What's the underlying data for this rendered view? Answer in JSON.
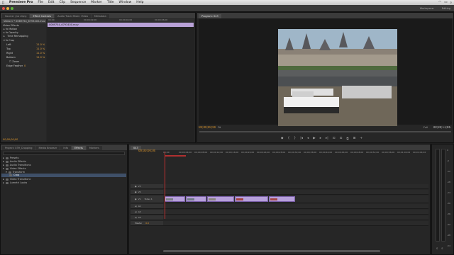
{
  "menubar": {
    "app_name": "Premiere Pro",
    "items": [
      "File",
      "Edit",
      "Clip",
      "Sequence",
      "Marker",
      "Title",
      "Window",
      "Help"
    ]
  },
  "titlebar": {
    "workspace_label": "Workspace:",
    "workspace_value": "Editing"
  },
  "effect_controls": {
    "tabs": [
      "Source: (no clips)",
      "Effect Controls",
      "Audio Track Mixer: Video",
      "Metadata"
    ],
    "clip_label": "Video 1 * 0069754_6793400.mov",
    "section": "Video Effects",
    "rows": [
      "Motion",
      "Opacity",
      "Time Remapping",
      "Crop",
      "Left",
      "Top",
      "Right",
      "Bottom",
      "Zoom",
      "Edge Feather"
    ],
    "values": {
      "left": "11.0 %",
      "top": "11.0 %",
      "right": "11.0 %",
      "bottom": "11.0 %",
      "edge": "0"
    },
    "timeline_clip": "0069754_6793400.mov",
    "ruler": [
      "00;00",
      "00;00;02;00",
      "00;00;04;00",
      "00;00;06;00"
    ],
    "timecode": "00;00;00;00"
  },
  "program": {
    "tab": "Program: 043",
    "timecode": "00;00;00;00",
    "fit": "Fit",
    "full": "Full",
    "duration": "00;00;11;06",
    "controls": [
      "◆",
      "{",
      "}",
      "|◂",
      "◂",
      "▶",
      "▸",
      "▸|",
      "⊡",
      "⊡",
      "⧉",
      "⊞",
      "+"
    ]
  },
  "project": {
    "tabs": [
      "Project: 039_Cropping",
      "Media Browser",
      "Info",
      "Effects",
      "Markers"
    ],
    "active_tab": "Effects",
    "items": [
      "Presets",
      "Audio Effects",
      "Audio Transitions",
      "Video Effects",
      "Transform",
      "Crop",
      "Video Transitions",
      "Lumetri Looks"
    ]
  },
  "timeline": {
    "tab": "043",
    "timecode": "00;00;00;00",
    "ruler": [
      "00;00",
      "00;00;04;00",
      "00;00;08;00",
      "00;00;12;00",
      "00;00;16;00",
      "00;00;20;00",
      "00;00;24;00",
      "00;00;28;00",
      "00;00;32;00",
      "00;00;36;00",
      "00;00;40;00",
      "00;00;44;00",
      "00;00;48;00",
      "00;00;52;00",
      "00;00;56;00",
      "00;01;00;02",
      "00;01;04;02"
    ],
    "tracks": [
      {
        "name": "V3"
      },
      {
        "name": "V2"
      },
      {
        "name": "V1",
        "label": "Video 1"
      },
      {
        "name": "A1"
      },
      {
        "name": "A2"
      },
      {
        "name": "A3"
      },
      {
        "name": "Master"
      }
    ],
    "master_value": "0.0"
  },
  "meters": {
    "scale": [
      "0",
      "-6",
      "-12",
      "-18",
      "-24",
      "-30",
      "-36",
      "-42",
      "-48",
      "-54",
      "dB"
    ],
    "buttons": [
      "S",
      "S"
    ]
  },
  "colors": {
    "accent_timecode": "#e39a2b",
    "clip_purple": "#b7a0db",
    "playhead": "#c03030"
  }
}
